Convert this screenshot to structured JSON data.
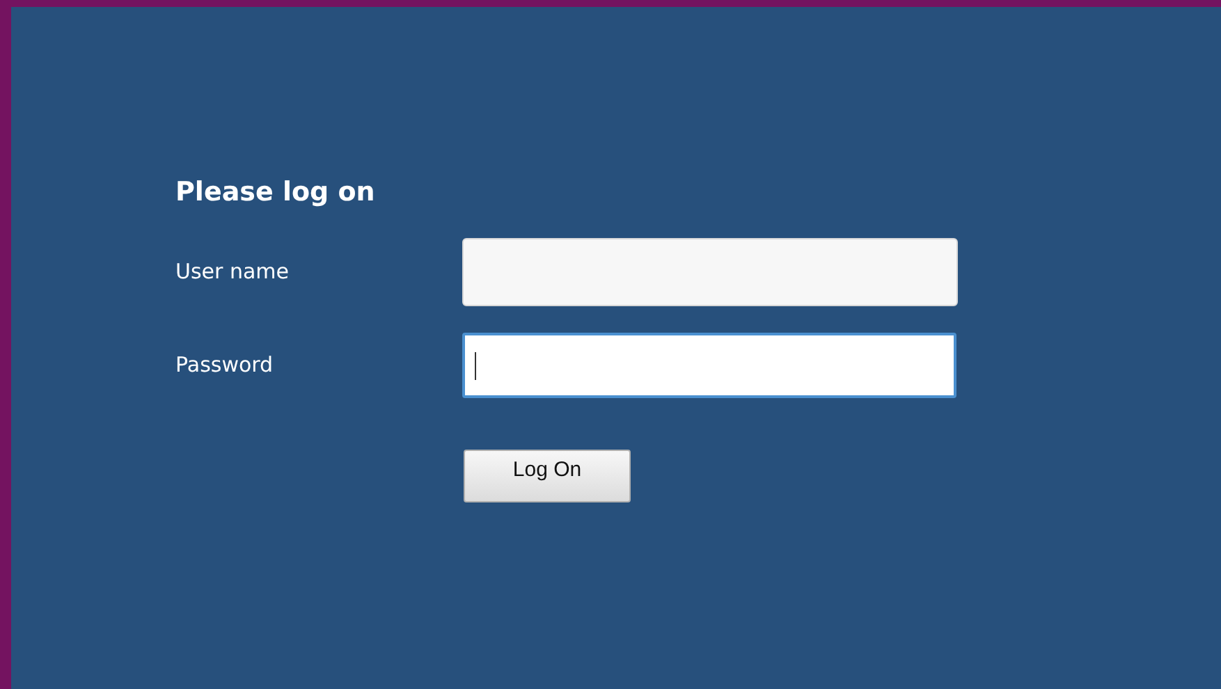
{
  "heading": "Please log on",
  "fields": [
    {
      "label": "User name",
      "focused": false
    },
    {
      "label": "Password",
      "focused": true
    }
  ],
  "button": "Log On"
}
